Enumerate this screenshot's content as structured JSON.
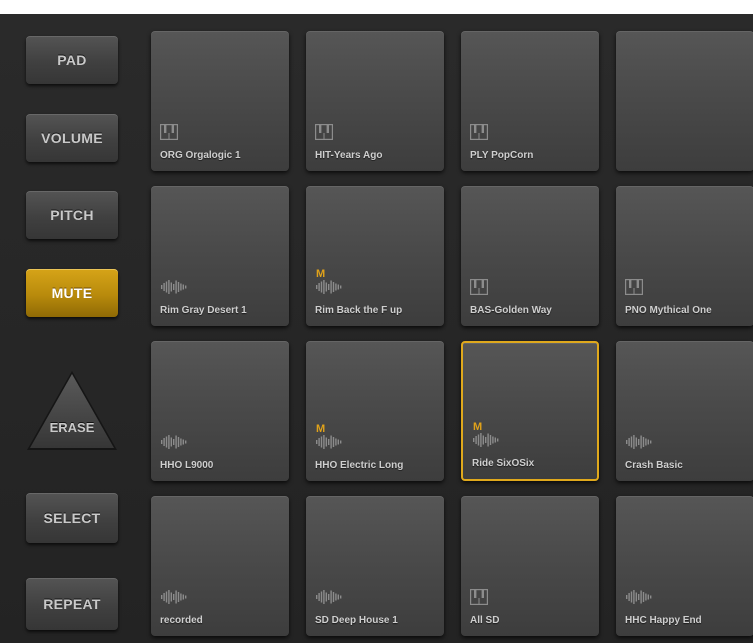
{
  "side_buttons": {
    "pad": "PAD",
    "volume": "VOLUME",
    "pitch": "PITCH",
    "mute": "MUTE",
    "erase": "ERASE",
    "select": "SELECT",
    "repeat": "REPEAT"
  },
  "active_mode": "MUTE",
  "accent_color": "#e0a91c",
  "pads": [
    {
      "label": "ORG Orgalogic 1",
      "icon": "keyboard-icon",
      "muted": false
    },
    {
      "label": "HIT-Years Ago",
      "icon": "keyboard-icon",
      "muted": false
    },
    {
      "label": "PLY PopCorn",
      "icon": "keyboard-icon",
      "muted": false
    },
    {
      "label": "",
      "icon": "",
      "muted": false
    },
    {
      "label": "Rim Gray Desert 1",
      "icon": "waveform-icon",
      "muted": false
    },
    {
      "label": "Rim Back the F up",
      "icon": "waveform-icon",
      "muted": true,
      "mute_label": "M"
    },
    {
      "label": "BAS-Golden Way",
      "icon": "keyboard-icon",
      "muted": false
    },
    {
      "label": "PNO Mythical One",
      "icon": "keyboard-icon",
      "muted": false
    },
    {
      "label": "HHO L9000",
      "icon": "waveform-icon",
      "muted": false
    },
    {
      "label": "HHO Electric Long",
      "icon": "waveform-icon",
      "muted": true,
      "mute_label": "M"
    },
    {
      "label": "Ride SixOSix",
      "icon": "waveform-icon",
      "muted": true,
      "mute_label": "M",
      "selected": true
    },
    {
      "label": "Crash Basic",
      "icon": "waveform-icon",
      "muted": false
    },
    {
      "label": "recorded",
      "icon": "waveform-icon",
      "muted": false
    },
    {
      "label": "SD Deep House 1",
      "icon": "waveform-icon",
      "muted": false
    },
    {
      "label": "All SD",
      "icon": "keyboard-icon",
      "muted": false
    },
    {
      "label": "HHC Happy End",
      "icon": "waveform-icon",
      "muted": false
    }
  ]
}
